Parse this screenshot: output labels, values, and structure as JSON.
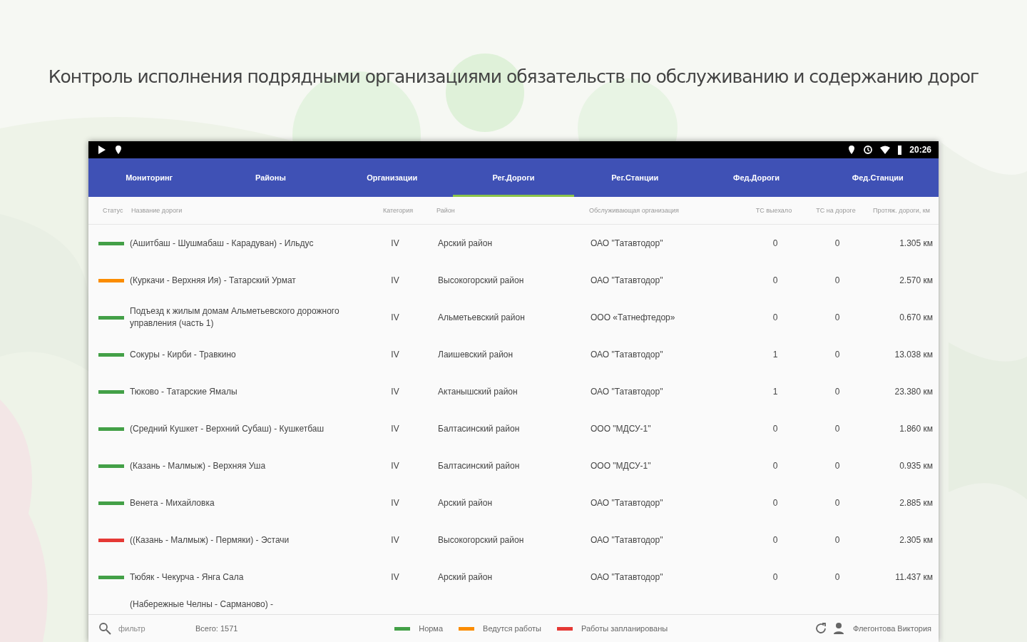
{
  "headline": "Контроль исполнения подрядными организациями обязательств по обслуживанию и содержанию дорог",
  "status_bar": {
    "time": "20:26"
  },
  "tabs": [
    {
      "label": "Мониторинг",
      "selected": false
    },
    {
      "label": "Районы",
      "selected": false
    },
    {
      "label": "Организации",
      "selected": false
    },
    {
      "label": "Рег.Дороги",
      "selected": true
    },
    {
      "label": "Рег.Станции",
      "selected": false
    },
    {
      "label": "Фед.Дороги",
      "selected": false
    },
    {
      "label": "Фед.Станции",
      "selected": false
    }
  ],
  "table": {
    "columns": [
      "Статус",
      "Название дороги",
      "Категория",
      "Район",
      "Обслуживающая организация",
      "ТС выехало",
      "ТС на дороге",
      "Протяж. дороги, км"
    ],
    "rows": [
      {
        "kind": "full",
        "color": "#43a047",
        "name": "(Ашитбаш - Шушмабаш - Карадуван) - Ильдус",
        "category": "IV",
        "district": "Арский район",
        "organization": "ОАО \"Татавтодор\"",
        "vehicles_out": "0",
        "vehicles_on_road": "0",
        "length": "1.305 км"
      },
      {
        "kind": "full",
        "color": "#fb8c00",
        "name": "(Куркачи - Верхняя Ия) - Татарский Урмат",
        "category": "IV",
        "district": "Высокогорский район",
        "organization": "ОАО \"Татавтодор\"",
        "vehicles_out": "0",
        "vehicles_on_road": "0",
        "length": "2.570 км"
      },
      {
        "kind": "full",
        "color": "#43a047",
        "name": "Подъезд к жилым домам Альметьевского дорожного управления (часть 1)",
        "category": "IV",
        "district": "Альметьевский район",
        "organization": "ООО «Татнефтедор»",
        "vehicles_out": "0",
        "vehicles_on_road": "0",
        "length": "0.670 км"
      },
      {
        "kind": "full",
        "color": "#43a047",
        "name": "Сокуры - Кирби - Травкино",
        "category": "IV",
        "district": "Лаишевский район",
        "organization": "ОАО \"Татавтодор\"",
        "vehicles_out": "1",
        "vehicles_on_road": "0",
        "length": "13.038 км"
      },
      {
        "kind": "full",
        "color": "#43a047",
        "name": "Тюково - Татарские Ямалы",
        "category": "IV",
        "district": "Актанышский район",
        "organization": "ОАО \"Татавтодор\"",
        "vehicles_out": "1",
        "vehicles_on_road": "0",
        "length": "23.380 км"
      },
      {
        "kind": "full",
        "color": "#43a047",
        "name": "(Средний Кушкет - Верхний Субаш) - Кушкетбаш",
        "category": "IV",
        "district": "Балтасинский район",
        "organization": "ООО \"МДСУ-1\"",
        "vehicles_out": "0",
        "vehicles_on_road": "0",
        "length": "1.860 км"
      },
      {
        "kind": "full",
        "color": "#43a047",
        "name": "(Казань - Малмыж) - Верхняя Уша",
        "category": "IV",
        "district": "Балтасинский район",
        "organization": "ООО \"МДСУ-1\"",
        "vehicles_out": "0",
        "vehicles_on_road": "0",
        "length": "0.935 км"
      },
      {
        "kind": "full",
        "color": "#43a047",
        "name": "Венета - Михайловка",
        "category": "IV",
        "district": "Арский район",
        "organization": "ОАО \"Татавтодор\"",
        "vehicles_out": "0",
        "vehicles_on_road": "0",
        "length": "2.885 км"
      },
      {
        "kind": "full",
        "color": "#e53935",
        "name": "((Казань - Малмыж) - Пермяки) - Эстачи",
        "category": "IV",
        "district": "Высокогорский район",
        "organization": "ОАО \"Татавтодор\"",
        "vehicles_out": "0",
        "vehicles_on_road": "0",
        "length": "2.305 км"
      },
      {
        "kind": "full",
        "color": "#43a047",
        "name": "Тюбяк - Чекурча - Янга Сала",
        "category": "IV",
        "district": "Арский район",
        "organization": "ОАО \"Татавтодор\"",
        "vehicles_out": "0",
        "vehicles_on_road": "0",
        "length": "11.437 км"
      },
      {
        "kind": "partial",
        "name": "(Набережные Челны - Сарманово) -"
      }
    ]
  },
  "footer": {
    "filter": {
      "placeholder": "фильтр"
    },
    "total": "Всего: 1571",
    "legend": [
      {
        "label": "Норма",
        "color": "#43a047"
      },
      {
        "label": "Ведутся работы",
        "color": "#fb8c00"
      },
      {
        "label": "Работы запланированы",
        "color": "#e53935"
      }
    ],
    "user": "Флегонтова Виктория"
  }
}
